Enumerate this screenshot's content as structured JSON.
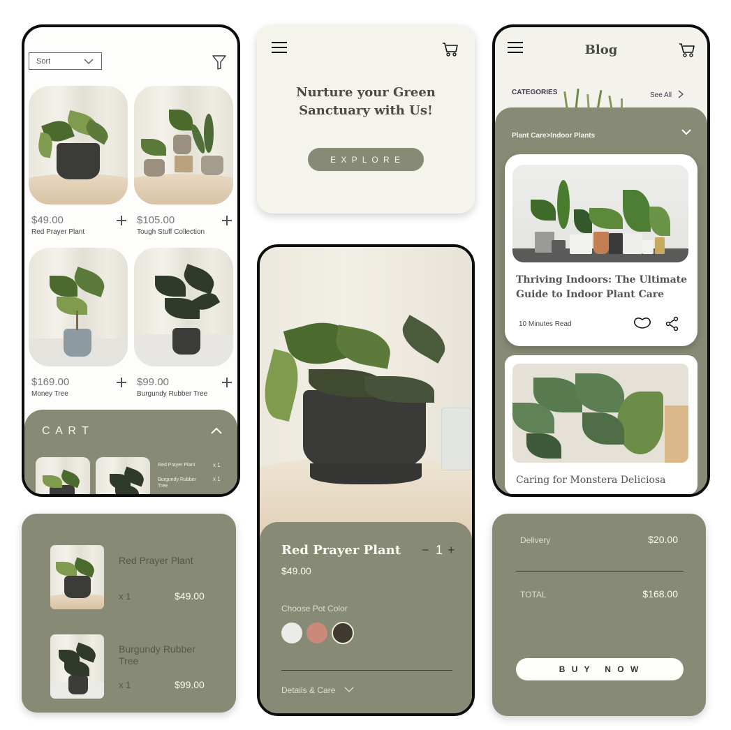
{
  "shop": {
    "sort_label": "Sort",
    "products": [
      {
        "price": "$49.00",
        "name": "Red Prayer Plant"
      },
      {
        "price": "$105.00",
        "name": "Tough Stuff Collection"
      },
      {
        "price": "$169.00",
        "name": "Money Tree"
      },
      {
        "price": "$99.00",
        "name": "Burgundy Rubber Tree"
      }
    ],
    "cart": {
      "title": "C A R T",
      "items": [
        {
          "name": "Red Prayer Plant",
          "qty": "x 1"
        },
        {
          "name": "Burgundy Rubber Tree",
          "qty": "x 1"
        }
      ]
    }
  },
  "hero": {
    "headline_line1": "Nurture your Green",
    "headline_line2": "Sanctuary with Us!",
    "cta": "E X P L O R E"
  },
  "blog": {
    "title": "Blog",
    "categories_label": "CATEGORIES",
    "see_all": "See All",
    "breadcrumb": "Plant Care>Indoor Plants",
    "posts": [
      {
        "title_line1": "Thriving Indoors: The Ultimate",
        "title_line2": "Guide to Indoor Plant Care",
        "read_time": "10 Minutes Read"
      },
      {
        "title_line1": "Caring for Monstera Deliciosa"
      }
    ]
  },
  "cart_summary": {
    "items": [
      {
        "name": "Red Prayer Plant",
        "qty": "x 1",
        "price": "$49.00"
      },
      {
        "name_line1": "Burgundy Rubber",
        "name_line2": "Tree",
        "qty": "x 1",
        "price": "$99.00"
      }
    ]
  },
  "product_detail": {
    "name": "Red Prayer Plant",
    "price": "$49.00",
    "quantity": "1",
    "minus": "−",
    "plus": "+",
    "pot_color_label": "Choose Pot Color",
    "pot_colors": [
      "#ebebe8",
      "#c98a79",
      "#3f3a2f"
    ],
    "selected_pot_color": "#3f3a2f",
    "details_label": "Details & Care"
  },
  "checkout": {
    "delivery_label": "Delivery",
    "delivery_value": "$20.00",
    "total_label": "TOTAL",
    "total_value": "$168.00",
    "buy_label": "B U Y   N O W"
  },
  "colors": {
    "olive": "#878a74",
    "cream": "#f4f3ec",
    "dark": "#0d0d0d"
  }
}
